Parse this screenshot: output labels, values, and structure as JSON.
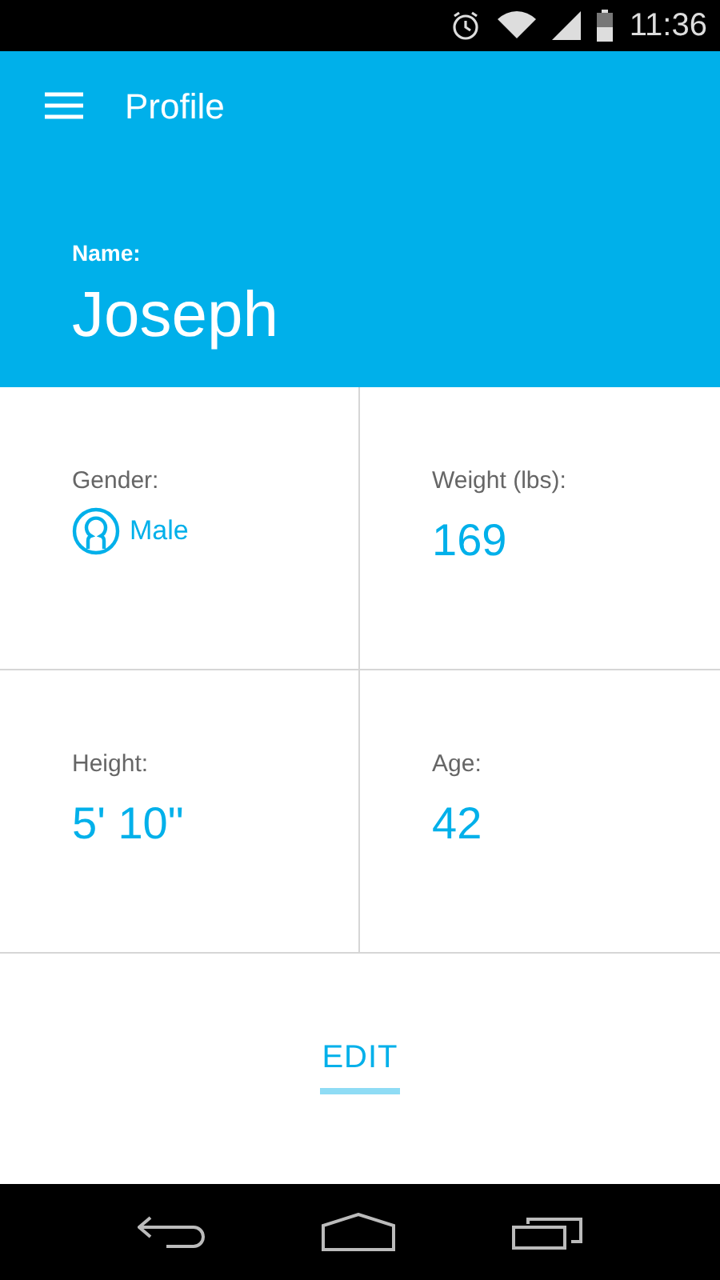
{
  "status_bar": {
    "time": "11:36"
  },
  "app_bar": {
    "title": "Profile"
  },
  "header": {
    "label": "Name:",
    "value": "Joseph"
  },
  "fields": [
    {
      "kind": "gender",
      "label": "Gender:",
      "value": "Male"
    },
    {
      "kind": "plain",
      "label": "Weight (lbs):",
      "value": "169"
    },
    {
      "kind": "plain",
      "label": "Height:",
      "value": "5' 10\""
    },
    {
      "kind": "plain",
      "label": "Age:",
      "value": "42"
    }
  ],
  "edit_button": {
    "label": "EDIT"
  }
}
